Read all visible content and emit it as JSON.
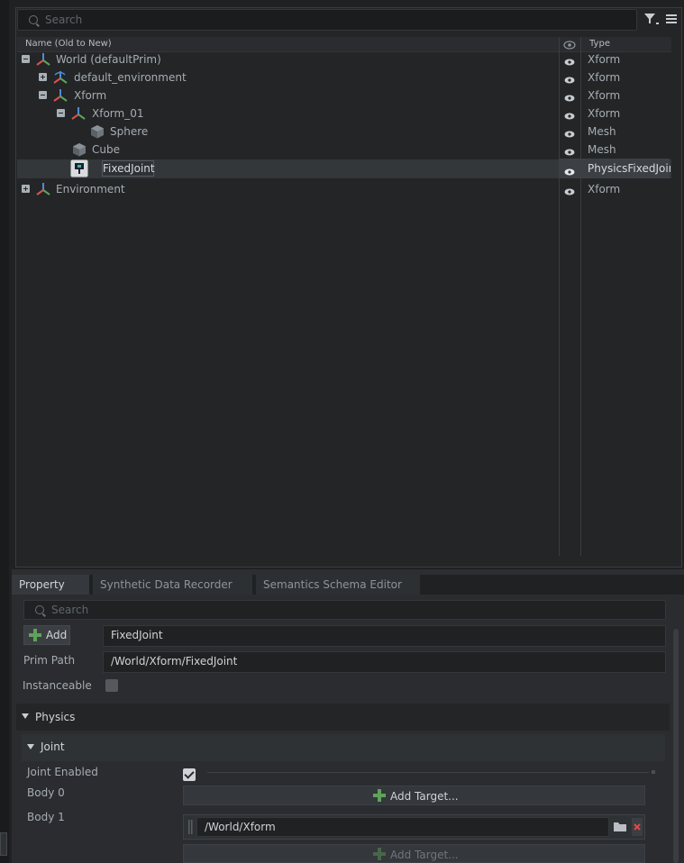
{
  "stage": {
    "search_placeholder": "Search",
    "columns": {
      "name": "Name (Old to New)",
      "type": "Type"
    },
    "rows": [
      {
        "label": "World (defaultPrim)",
        "type": "Xform"
      },
      {
        "label": "default_environment",
        "type": "Xform"
      },
      {
        "label": "Xform",
        "type": "Xform"
      },
      {
        "label": "Xform_01",
        "type": "Xform"
      },
      {
        "label": "Sphere",
        "type": "Mesh"
      },
      {
        "label": "Cube",
        "type": "Mesh"
      },
      {
        "label": "FixedJoint",
        "type": "PhysicsFixedJoint"
      },
      {
        "label": "Environment",
        "type": "Xform"
      }
    ]
  },
  "tabs": [
    {
      "label": "Property"
    },
    {
      "label": "Synthetic Data Recorder"
    },
    {
      "label": "Semantics Schema Editor"
    }
  ],
  "property": {
    "search_placeholder": "Search",
    "add_label": "Add",
    "name_value": "FixedJoint",
    "prim_path_label": "Prim Path",
    "prim_path_value": "/World/Xform/FixedJoint",
    "instanceable_label": "Instanceable",
    "physics_label": "Physics",
    "joint_label": "Joint",
    "joint_enabled_label": "Joint Enabled",
    "body0_label": "Body 0",
    "body1_label": "Body 1",
    "add_target_label": "Add Target...",
    "body1_value": "/World/Xform",
    "add_target_label_2": "Add Target..."
  },
  "colors": {
    "accent_green": "#5ea35a",
    "xform_red": "#d9534f",
    "xform_blue": "#4f8ad9"
  }
}
